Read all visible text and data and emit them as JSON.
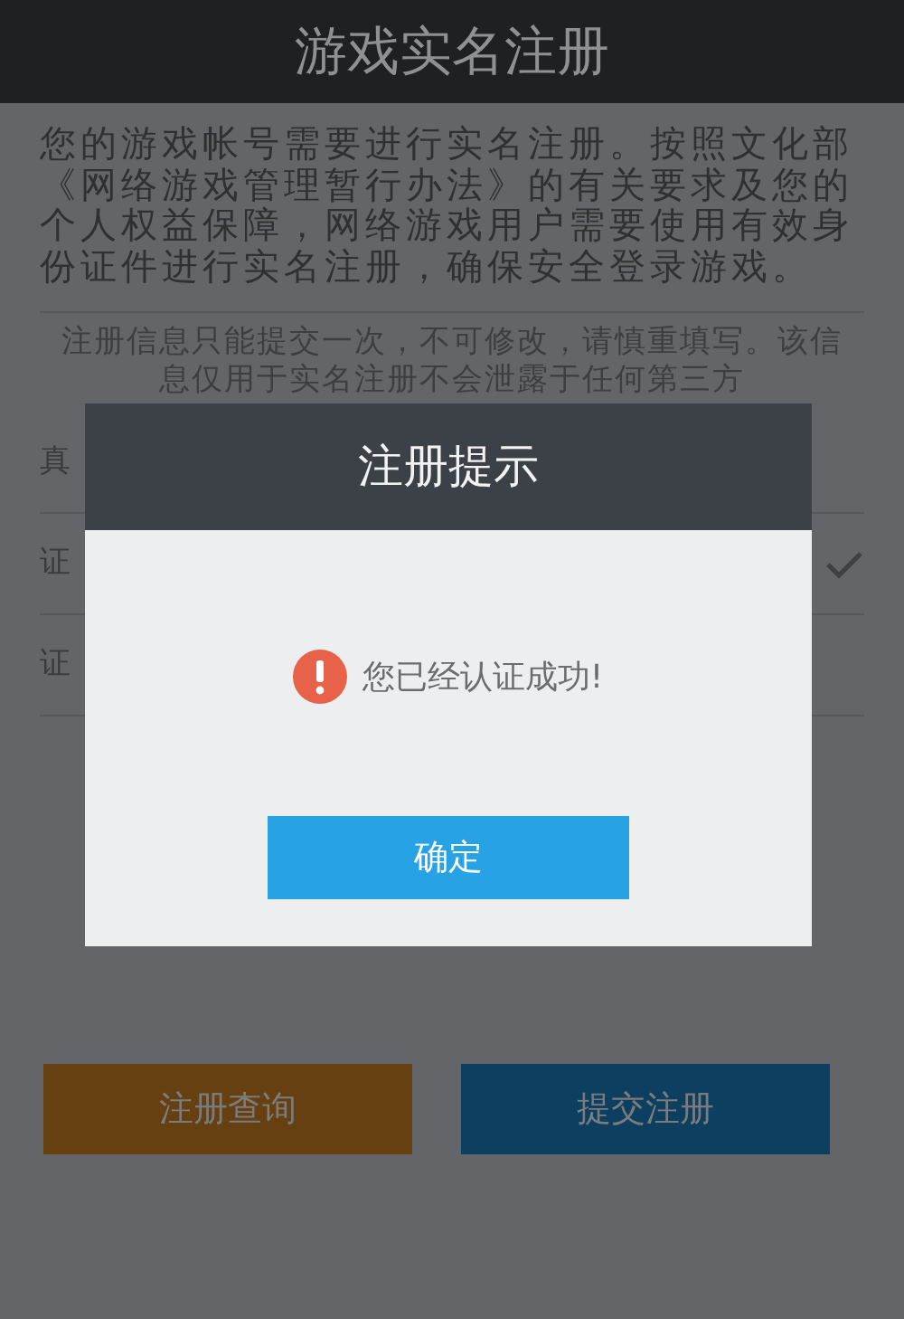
{
  "page": {
    "title": "游戏实名注册",
    "intro": "您的游戏帐号需要进行实名注册。按照文化部《网络游戏管理暂行办法》的有关要求及您的个人权益保障，网络游戏用户需要使用有效身份证件进行实名注册，确保安全登录游戏。",
    "notice": "注册信息只能提交一次，不可修改，请慎重填写。该信息仅用于实名注册不会泄露于任何第三方",
    "fields": [
      {
        "label": "真",
        "verified": false
      },
      {
        "label": "证",
        "verified": true
      },
      {
        "label": "证",
        "verified": false
      }
    ],
    "buttons": [
      {
        "label": "注册查询",
        "color": "#664010"
      },
      {
        "label": "提交注册",
        "color": "#0d3f61"
      }
    ]
  },
  "dialog": {
    "title": "注册提示",
    "message": "您已经认证成功!",
    "confirm": "确定"
  }
}
